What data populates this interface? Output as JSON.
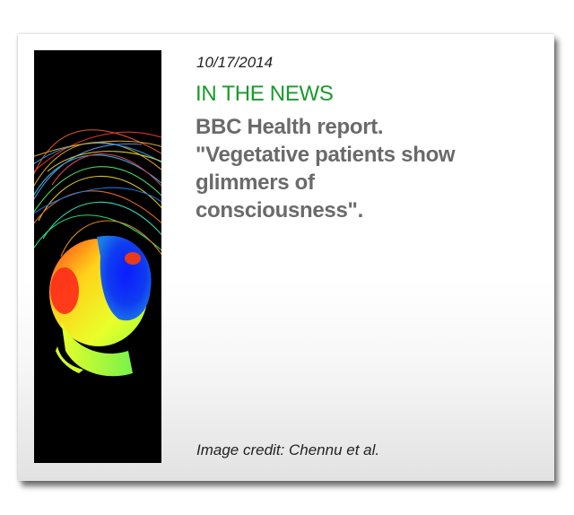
{
  "news_card": {
    "date": "10/17/2014",
    "kicker": "IN THE NEWS",
    "headline_lines": [
      "BBC Health report.",
      "\"Vegetative patients show",
      "glimmers of",
      "consciousness\"."
    ],
    "image_credit": "Image credit: Chennu et al.",
    "kicker_color": "#1a9a2a",
    "headline_color": "#6a6a6a"
  }
}
